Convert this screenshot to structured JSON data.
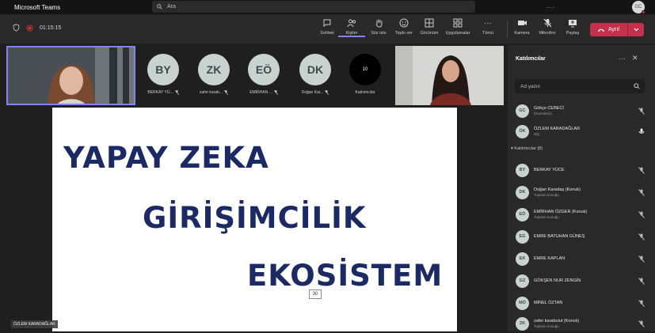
{
  "titlebar": {
    "app_name": "Microsoft Teams",
    "search_placeholder": "Ara",
    "avatar_initials": "GC",
    "menu_dots": "···"
  },
  "toolbar": {
    "timer": "01:15:15",
    "buttons": [
      {
        "label": "Sohbet"
      },
      {
        "label": "Kişiler"
      },
      {
        "label": "Söz iste"
      },
      {
        "label": "Tepki ver"
      },
      {
        "label": "Görünüm"
      },
      {
        "label": "Uygulamalar"
      },
      {
        "label": "Tümü"
      },
      {
        "label": "Kamera"
      },
      {
        "label": "Mikrofon"
      },
      {
        "label": "Paylaş"
      }
    ],
    "leave_label": "Ayrıl"
  },
  "gallery": {
    "tiles": [
      {
        "initials": "BY",
        "name": "BERKAY YÜ..."
      },
      {
        "initials": "ZK",
        "name": "zafer karab..."
      },
      {
        "initials": "EÖ",
        "name": "EMİRHAN ..."
      },
      {
        "initials": "DK",
        "name": "Doğan Kar..."
      },
      {
        "initials": "10",
        "name": "Katılımcılar"
      }
    ]
  },
  "slide": {
    "line1": "YAPAY ZEKA",
    "line2": "GİRİŞİMCİLİK",
    "line3": "EKOSİSTEM",
    "page_number": "30"
  },
  "speaker_name": "ÖZLEM KARADAĞLAR",
  "panel": {
    "title": "Katılımcılar",
    "search_placeholder": "Ad yazın",
    "organizers": [
      {
        "initials": "GC",
        "name": "Gökçe CEBECİ",
        "role": "Düzenleyici"
      },
      {
        "initials": "ÖK",
        "name": "ÖZLEM KARADAĞLAR",
        "role": "Diğ"
      }
    ],
    "section_label": "Katılımcılar (8)",
    "attendees": [
      {
        "initials": "BY",
        "name": "BERKAY YÜCE",
        "role": ""
      },
      {
        "initials": "DK",
        "name": "Doğan Karadaş (Konuk)",
        "role": "Toplantı konuğu"
      },
      {
        "initials": "EÖ",
        "name": "EMİRHAN ÖZGER (Konuk)",
        "role": "Toplantı konuğu"
      },
      {
        "initials": "EG",
        "name": "EMRE BATUHAN GÜNEŞ",
        "role": ""
      },
      {
        "initials": "EK",
        "name": "EMRE KAPLAN",
        "role": ""
      },
      {
        "initials": "GZ",
        "name": "GÖKŞEN NUR ZENGİN",
        "role": ""
      },
      {
        "initials": "MÖ",
        "name": "MİNEL ÖZTAN",
        "role": ""
      },
      {
        "initials": "ZK",
        "name": "zafer karabulut (Konuk)",
        "role": "Toplantı konuğu"
      }
    ]
  },
  "colors": {
    "accent": "#7f85f5",
    "leave": "#c4314b",
    "slide_text": "#1b2a63"
  }
}
